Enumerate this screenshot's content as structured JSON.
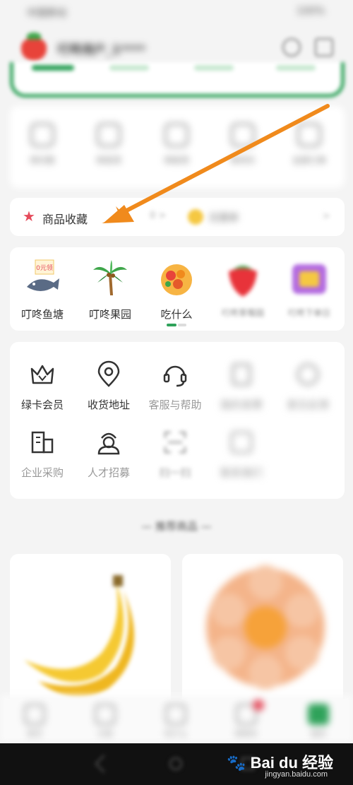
{
  "status_bar": {
    "left": "中国移动",
    "right": "100%"
  },
  "header": {
    "username": "叮咚用户_1****"
  },
  "orders": {
    "items": [
      {
        "label": "待付款",
        "icon": "wallet-icon"
      },
      {
        "label": "待发货",
        "icon": "box-icon"
      },
      {
        "label": "待收货",
        "icon": "truck-icon"
      },
      {
        "label": "待评价",
        "icon": "comment-icon"
      },
      {
        "label": "全部订单",
        "icon": "list-icon"
      }
    ]
  },
  "collect": {
    "label": "商品收藏",
    "count": "0 >",
    "coupon_label": "优惠券",
    "coupon_chevron": ">"
  },
  "fun": {
    "items": [
      {
        "label": "叮咚鱼塘",
        "badge": "0元领",
        "icon": "fish-pond-icon"
      },
      {
        "label": "叮咚果园",
        "icon": "palm-tree-icon"
      },
      {
        "label": "吃什么",
        "icon": "food-bowl-icon"
      },
      {
        "label": "叮咚草莓园",
        "icon": "strawberry-icon"
      },
      {
        "label": "叮咚下单日",
        "icon": "gift-icon"
      }
    ]
  },
  "services": {
    "row1": [
      {
        "label": "绿卡会员",
        "icon": "crown-icon"
      },
      {
        "label": "收货地址",
        "icon": "location-icon"
      },
      {
        "label": "客服与帮助",
        "icon": "headset-icon"
      },
      {
        "label": "我的发票",
        "icon": "invoice-icon"
      },
      {
        "label": "意见反馈",
        "icon": "feedback-icon"
      }
    ],
    "row2": [
      {
        "label": "企业采购",
        "icon": "building-icon"
      },
      {
        "label": "人才招募",
        "icon": "recruit-icon"
      },
      {
        "label": "扫一扫",
        "icon": "scan-icon"
      },
      {
        "label": "联系我们",
        "icon": "contact-icon"
      }
    ]
  },
  "recommend": {
    "title": "— 推荐商品 —"
  },
  "tabbar": {
    "items": [
      {
        "label": "首页",
        "icon": "home-icon"
      },
      {
        "label": "分类",
        "icon": "category-icon"
      },
      {
        "label": "吃什么",
        "icon": "bowl-icon"
      },
      {
        "label": "购物车",
        "icon": "cart-icon"
      },
      {
        "label": "我的",
        "icon": "profile-icon"
      }
    ]
  },
  "watermark": {
    "brand": "Bai du 经验",
    "sub": "jingyan.baidu.com"
  },
  "colors": {
    "accent_green": "#2fa25a",
    "arrow_orange": "#f08a1c",
    "star_red": "#e54b5b"
  }
}
